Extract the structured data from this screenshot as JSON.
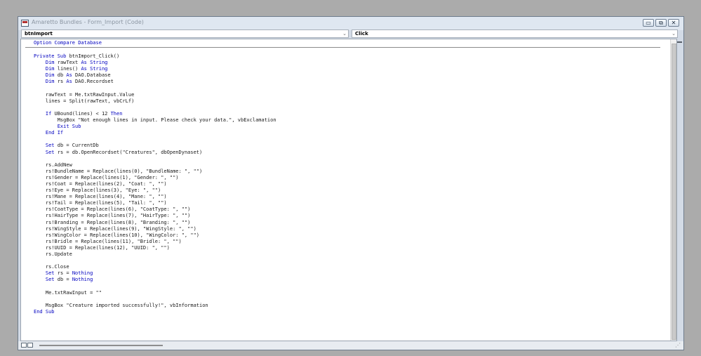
{
  "window": {
    "title": "Amaretto Bundles - Form_Import (Code)",
    "controls": {
      "minimize": "▭",
      "restore": "⧉",
      "close": "✕"
    }
  },
  "object_combo": {
    "value": "btnImport",
    "arrow": "⌄"
  },
  "procedure_combo": {
    "value": "Click",
    "arrow": "⌄"
  },
  "code": {
    "option_line": "Option Compare Database",
    "lines": [
      "",
      "Private Sub btnImport_Click()",
      "    Dim rawText As String",
      "    Dim lines() As String",
      "    Dim db As DAO.Database",
      "    Dim rs As DAO.Recordset",
      "",
      "    rawText = Me.txtRawInput.Value",
      "    lines = Split(rawText, vbCrLf)",
      "",
      "    If UBound(lines) < 12 Then",
      "        MsgBox \"Not enough lines in input. Please check your data.\", vbExclamation",
      "        Exit Sub",
      "    End If",
      "",
      "    Set db = CurrentDb",
      "    Set rs = db.OpenRecordset(\"Creatures\", dbOpenDynaset)",
      "",
      "    rs.AddNew",
      "    rs!BundleName = Replace(lines(0), \"BundleName: \", \"\")",
      "    rs!Gender = Replace(lines(1), \"Gender: \", \"\")",
      "    rs!Coat = Replace(lines(2), \"Coat: \", \"\")",
      "    rs!Eye = Replace(lines(3), \"Eye: \", \"\")",
      "    rs!Mane = Replace(lines(4), \"Mane: \", \"\")",
      "    rs!Tail = Replace(lines(5), \"Tail: \", \"\")",
      "    rs!CoatType = Replace(lines(6), \"CoatType: \", \"\")",
      "    rs!HairType = Replace(lines(7), \"HairType: \", \"\")",
      "    rs!Branding = Replace(lines(8), \"Branding: \", \"\")",
      "    rs!WingStyle = Replace(lines(9), \"WingStyle: \", \"\")",
      "    rs!WingColor = Replace(lines(10), \"WingColor: \", \"\")",
      "    rs!Bridle = Replace(lines(11), \"Bridle: \", \"\")",
      "    rs!UUID = Replace(lines(12), \"UUID: \", \"\")",
      "    rs.Update",
      "",
      "    rs.Close",
      "    Set rs = Nothing",
      "    Set db = Nothing",
      "",
      "    Me.txtRawInput = \"\"",
      "",
      "    MsgBox \"Creature imported successfully!\", vbInformation",
      "End Sub"
    ]
  },
  "colors": {
    "keyword": "#0000c0",
    "text": "#1a1a1a"
  }
}
